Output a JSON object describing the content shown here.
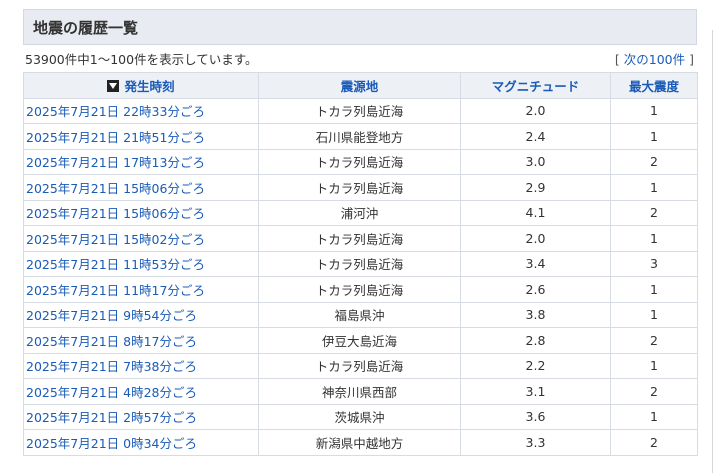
{
  "page": {
    "title": "地震の履歴一覧",
    "summary": "53900件中1～100件を表示しています。",
    "next_prefix": "[ ",
    "next_label": "次の100件",
    "next_suffix": " ]"
  },
  "table": {
    "headers": {
      "time": "発生時刻",
      "epicenter": "震源地",
      "magnitude": "マグニチュード",
      "intensity": "最大震度"
    },
    "rows": [
      {
        "time": "2025年7月21日 22時33分ごろ",
        "epicenter": "トカラ列島近海",
        "magnitude": "2.0",
        "intensity": "1"
      },
      {
        "time": "2025年7月21日 21時51分ごろ",
        "epicenter": "石川県能登地方",
        "magnitude": "2.4",
        "intensity": "1"
      },
      {
        "time": "2025年7月21日 17時13分ごろ",
        "epicenter": "トカラ列島近海",
        "magnitude": "3.0",
        "intensity": "2"
      },
      {
        "time": "2025年7月21日 15時06分ごろ",
        "epicenter": "トカラ列島近海",
        "magnitude": "2.9",
        "intensity": "1"
      },
      {
        "time": "2025年7月21日 15時06分ごろ",
        "epicenter": "浦河沖",
        "magnitude": "4.1",
        "intensity": "2"
      },
      {
        "time": "2025年7月21日 15時02分ごろ",
        "epicenter": "トカラ列島近海",
        "magnitude": "2.0",
        "intensity": "1"
      },
      {
        "time": "2025年7月21日 11時53分ごろ",
        "epicenter": "トカラ列島近海",
        "magnitude": "3.4",
        "intensity": "3"
      },
      {
        "time": "2025年7月21日 11時17分ごろ",
        "epicenter": "トカラ列島近海",
        "magnitude": "2.6",
        "intensity": "1"
      },
      {
        "time": "2025年7月21日 9時54分ごろ",
        "epicenter": "福島県沖",
        "magnitude": "3.8",
        "intensity": "1"
      },
      {
        "time": "2025年7月21日 8時17分ごろ",
        "epicenter": "伊豆大島近海",
        "magnitude": "2.8",
        "intensity": "2"
      },
      {
        "time": "2025年7月21日 7時38分ごろ",
        "epicenter": "トカラ列島近海",
        "magnitude": "2.2",
        "intensity": "1"
      },
      {
        "time": "2025年7月21日 4時28分ごろ",
        "epicenter": "神奈川県西部",
        "magnitude": "3.1",
        "intensity": "2"
      },
      {
        "time": "2025年7月21日 2時57分ごろ",
        "epicenter": "茨城県沖",
        "magnitude": "3.6",
        "intensity": "1"
      },
      {
        "time": "2025年7月21日 0時34分ごろ",
        "epicenter": "新潟県中越地方",
        "magnitude": "3.3",
        "intensity": "2"
      }
    ]
  },
  "colors": {
    "link": "#1a5bb8",
    "header_bg": "#edf0f5",
    "title_bg": "#e8ebf1",
    "border": "#d7dbe3"
  },
  "icons": {
    "sort": "sort-descending-icon"
  }
}
